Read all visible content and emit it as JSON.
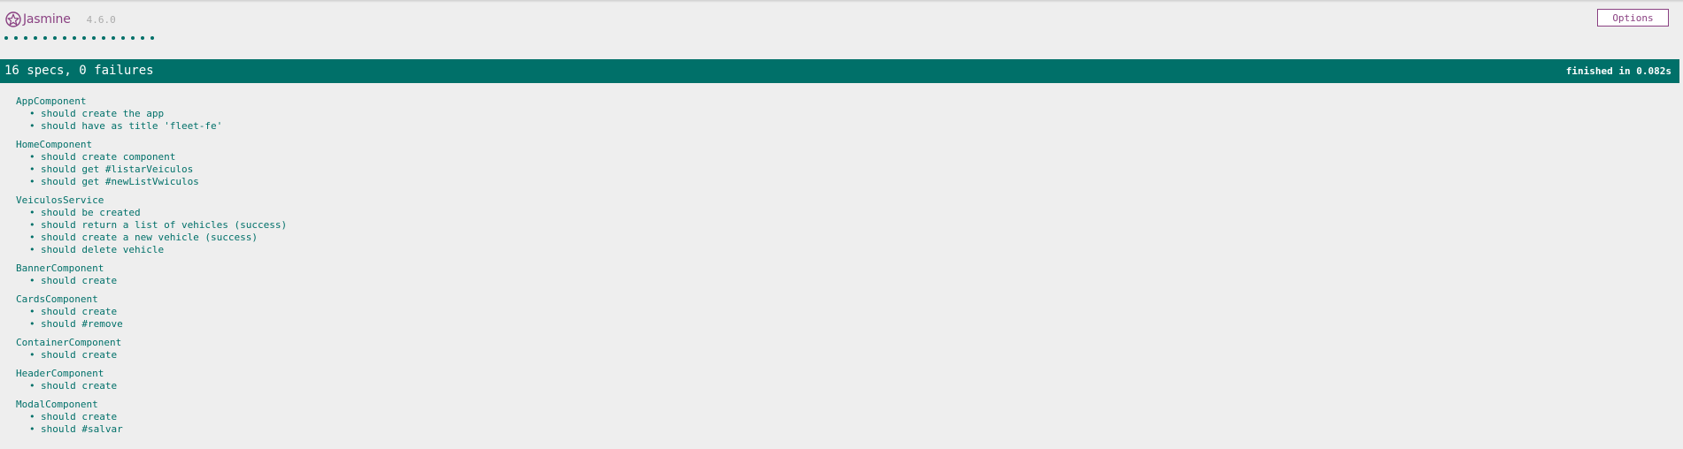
{
  "app": {
    "name": "Jasmine",
    "version": "4.6.0",
    "options_label": "Options",
    "dot_count": 16
  },
  "summary": {
    "overall": "16 specs, 0 failures",
    "duration": "finished in 0.082s"
  },
  "suites": [
    {
      "name": "AppComponent",
      "specs": [
        "should create the app",
        "should have as title 'fleet-fe'"
      ]
    },
    {
      "name": "HomeComponent",
      "specs": [
        "should create component",
        "should get #listarVeiculos",
        "should get #newListVwiculos"
      ]
    },
    {
      "name": "VeiculosService",
      "specs": [
        "should be created",
        "should return a list of vehicles (success)",
        "should create a new vehicle (success)",
        "should delete vehicle"
      ]
    },
    {
      "name": "BannerComponent",
      "specs": [
        "should create"
      ]
    },
    {
      "name": "CardsComponent",
      "specs": [
        "should create",
        "should #remove"
      ]
    },
    {
      "name": "ContainerComponent",
      "specs": [
        "should create"
      ]
    },
    {
      "name": "HeaderComponent",
      "specs": [
        "should create"
      ]
    },
    {
      "name": "ModalComponent",
      "specs": [
        "should create",
        "should #salvar"
      ]
    }
  ],
  "colors": {
    "passed": "#007069",
    "brand": "#8a4182",
    "background": "#eeeeee"
  }
}
